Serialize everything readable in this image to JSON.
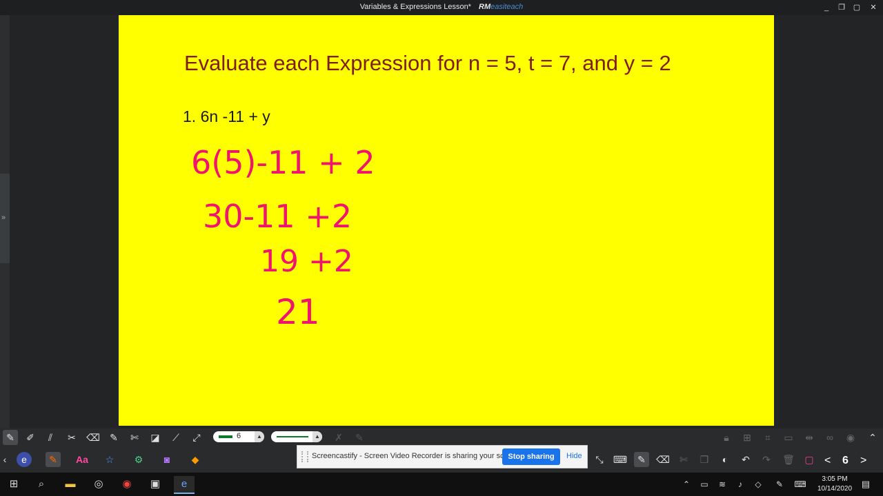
{
  "window": {
    "title": "Variables & Expressions Lesson*",
    "brand_bold": "RM",
    "brand_light": "easiteach",
    "controls": [
      "_",
      "❐",
      "▢",
      "✕"
    ]
  },
  "slide": {
    "heading": "Evaluate each Expression for n = 5, t = 7, and y = 2",
    "question": "1.  6n -11 + y",
    "handwriting": [
      "6(5)-11 + 2",
      "30-11 +2",
      "19 +2",
      "21"
    ],
    "background_color": "#ffff00",
    "ink_color": "#f0146e"
  },
  "toolbar": {
    "pen_size": "6",
    "page_number": "6",
    "prev_label": "<",
    "next_label": ">"
  },
  "screencastify": {
    "message": "Screencastify - Screen Video Recorder is sharing your screen.",
    "stop_label": "Stop sharing",
    "hide_label": "Hide"
  },
  "taskbar": {
    "time": "3:05 PM",
    "date": "10/14/2020"
  }
}
